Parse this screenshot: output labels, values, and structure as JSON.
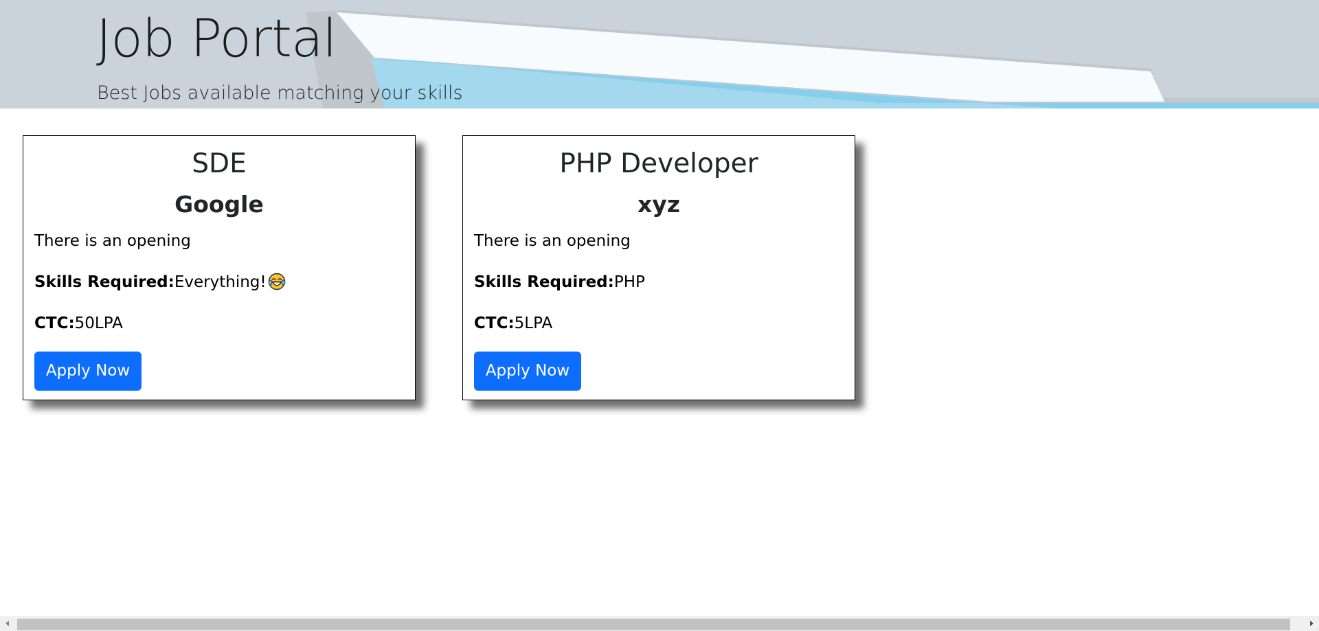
{
  "header": {
    "title": "Job Portal",
    "subtitle": "Best Jobs available matching your skills"
  },
  "jobs": [
    {
      "title": "SDE",
      "company": "Google",
      "description": "There is an opening",
      "skills_label": "Skills Required:",
      "skills": "Everything!",
      "skills_emoji": "laughing-tears-emoji",
      "ctc_label": "CTC:",
      "ctc": "50LPA",
      "apply_label": "Apply Now"
    },
    {
      "title": "PHP Developer",
      "company": "xyz",
      "description": "There is an opening",
      "skills_label": "Skills Required:",
      "skills": "PHP",
      "ctc_label": "CTC:",
      "ctc": "5LPA",
      "apply_label": "Apply Now"
    }
  ],
  "colors": {
    "banner": "#cbd3da",
    "button": "#0d6efd",
    "button_text": "#ffffff"
  }
}
